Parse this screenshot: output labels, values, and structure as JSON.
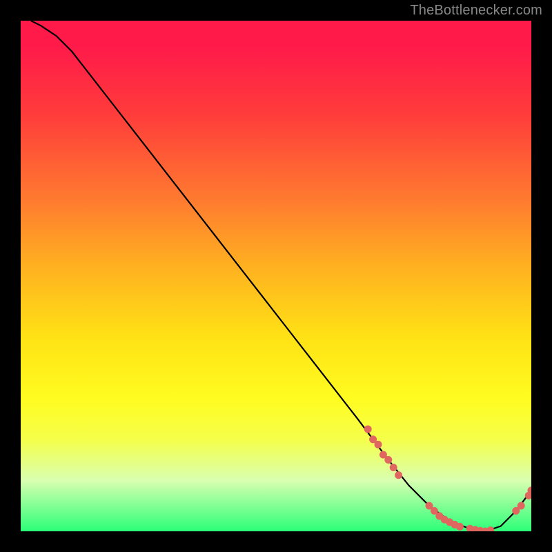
{
  "attribution": "TheBottlenecker.com",
  "chart_data": {
    "type": "line",
    "title": "",
    "xlabel": "",
    "ylabel": "",
    "xlim": [
      0,
      100
    ],
    "ylim": [
      0,
      100
    ],
    "series": [
      {
        "name": "curve",
        "x": [
          2,
          4,
          7,
          10,
          17,
          24,
          31,
          38,
          45,
          52,
          59,
          66,
          72,
          76,
          80,
          84,
          88,
          91,
          94,
          97,
          100
        ],
        "y": [
          100,
          99,
          97,
          94,
          85,
          76,
          67,
          58,
          49,
          40,
          31,
          22,
          14,
          9,
          5,
          2,
          0.5,
          0,
          1,
          4,
          8
        ]
      }
    ],
    "markers": [
      {
        "name": "cluster-top",
        "x": 68,
        "y": 20
      },
      {
        "name": "cluster-top",
        "x": 69,
        "y": 18
      },
      {
        "name": "cluster-top",
        "x": 70,
        "y": 17
      },
      {
        "name": "cluster-top",
        "x": 71,
        "y": 15
      },
      {
        "name": "cluster-top",
        "x": 72,
        "y": 14
      },
      {
        "name": "cluster-top",
        "x": 73,
        "y": 12.5
      },
      {
        "name": "cluster-top",
        "x": 74,
        "y": 11
      },
      {
        "name": "cluster-bottom",
        "x": 80,
        "y": 5
      },
      {
        "name": "cluster-bottom",
        "x": 81,
        "y": 4
      },
      {
        "name": "cluster-bottom",
        "x": 82,
        "y": 3
      },
      {
        "name": "cluster-bottom",
        "x": 83,
        "y": 2.3
      },
      {
        "name": "cluster-bottom",
        "x": 84,
        "y": 1.8
      },
      {
        "name": "cluster-bottom",
        "x": 85,
        "y": 1.3
      },
      {
        "name": "cluster-bottom",
        "x": 86,
        "y": 0.9
      },
      {
        "name": "cluster-bottom",
        "x": 88,
        "y": 0.5
      },
      {
        "name": "cluster-bottom",
        "x": 89,
        "y": 0.3
      },
      {
        "name": "cluster-bottom",
        "x": 90,
        "y": 0.1
      },
      {
        "name": "cluster-bottom",
        "x": 91,
        "y": 0.0
      },
      {
        "name": "cluster-bottom",
        "x": 92,
        "y": 0.2
      },
      {
        "name": "cluster-rise",
        "x": 97,
        "y": 4
      },
      {
        "name": "cluster-rise",
        "x": 98,
        "y": 5
      },
      {
        "name": "cluster-rise",
        "x": 99.5,
        "y": 7
      },
      {
        "name": "cluster-rise",
        "x": 100,
        "y": 8
      }
    ],
    "marker_color": "#e06660",
    "line_color": "#000000"
  }
}
